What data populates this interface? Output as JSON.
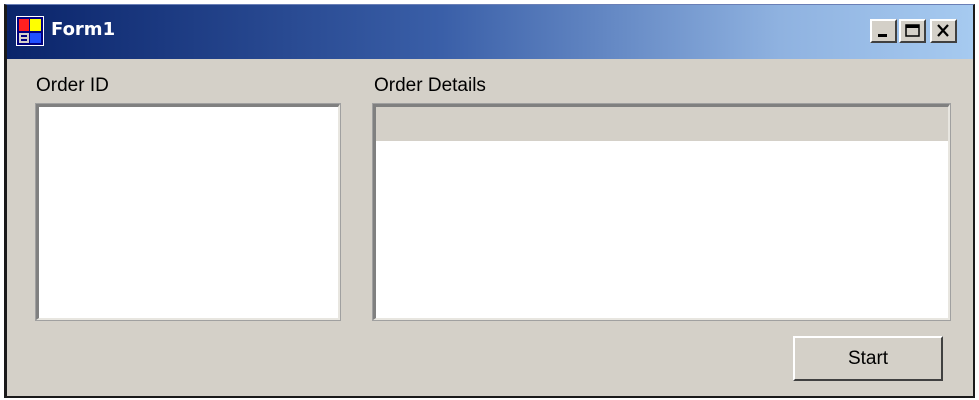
{
  "window": {
    "title": "Form1",
    "icon": "form-app-icon",
    "controls": {
      "minimize_icon": "minimize-icon",
      "maximize_icon": "maximize-icon",
      "close_icon": "close-icon"
    }
  },
  "labels": {
    "order_id": "Order ID",
    "order_details": "Order Details"
  },
  "order_id_list": {
    "items": []
  },
  "order_details_grid": {
    "columns": [],
    "rows": []
  },
  "buttons": {
    "start": "Start"
  },
  "colors": {
    "title_bar_start": "#0a246a",
    "title_bar_end": "#a6caf0",
    "window_face": "#d4d0c8"
  }
}
